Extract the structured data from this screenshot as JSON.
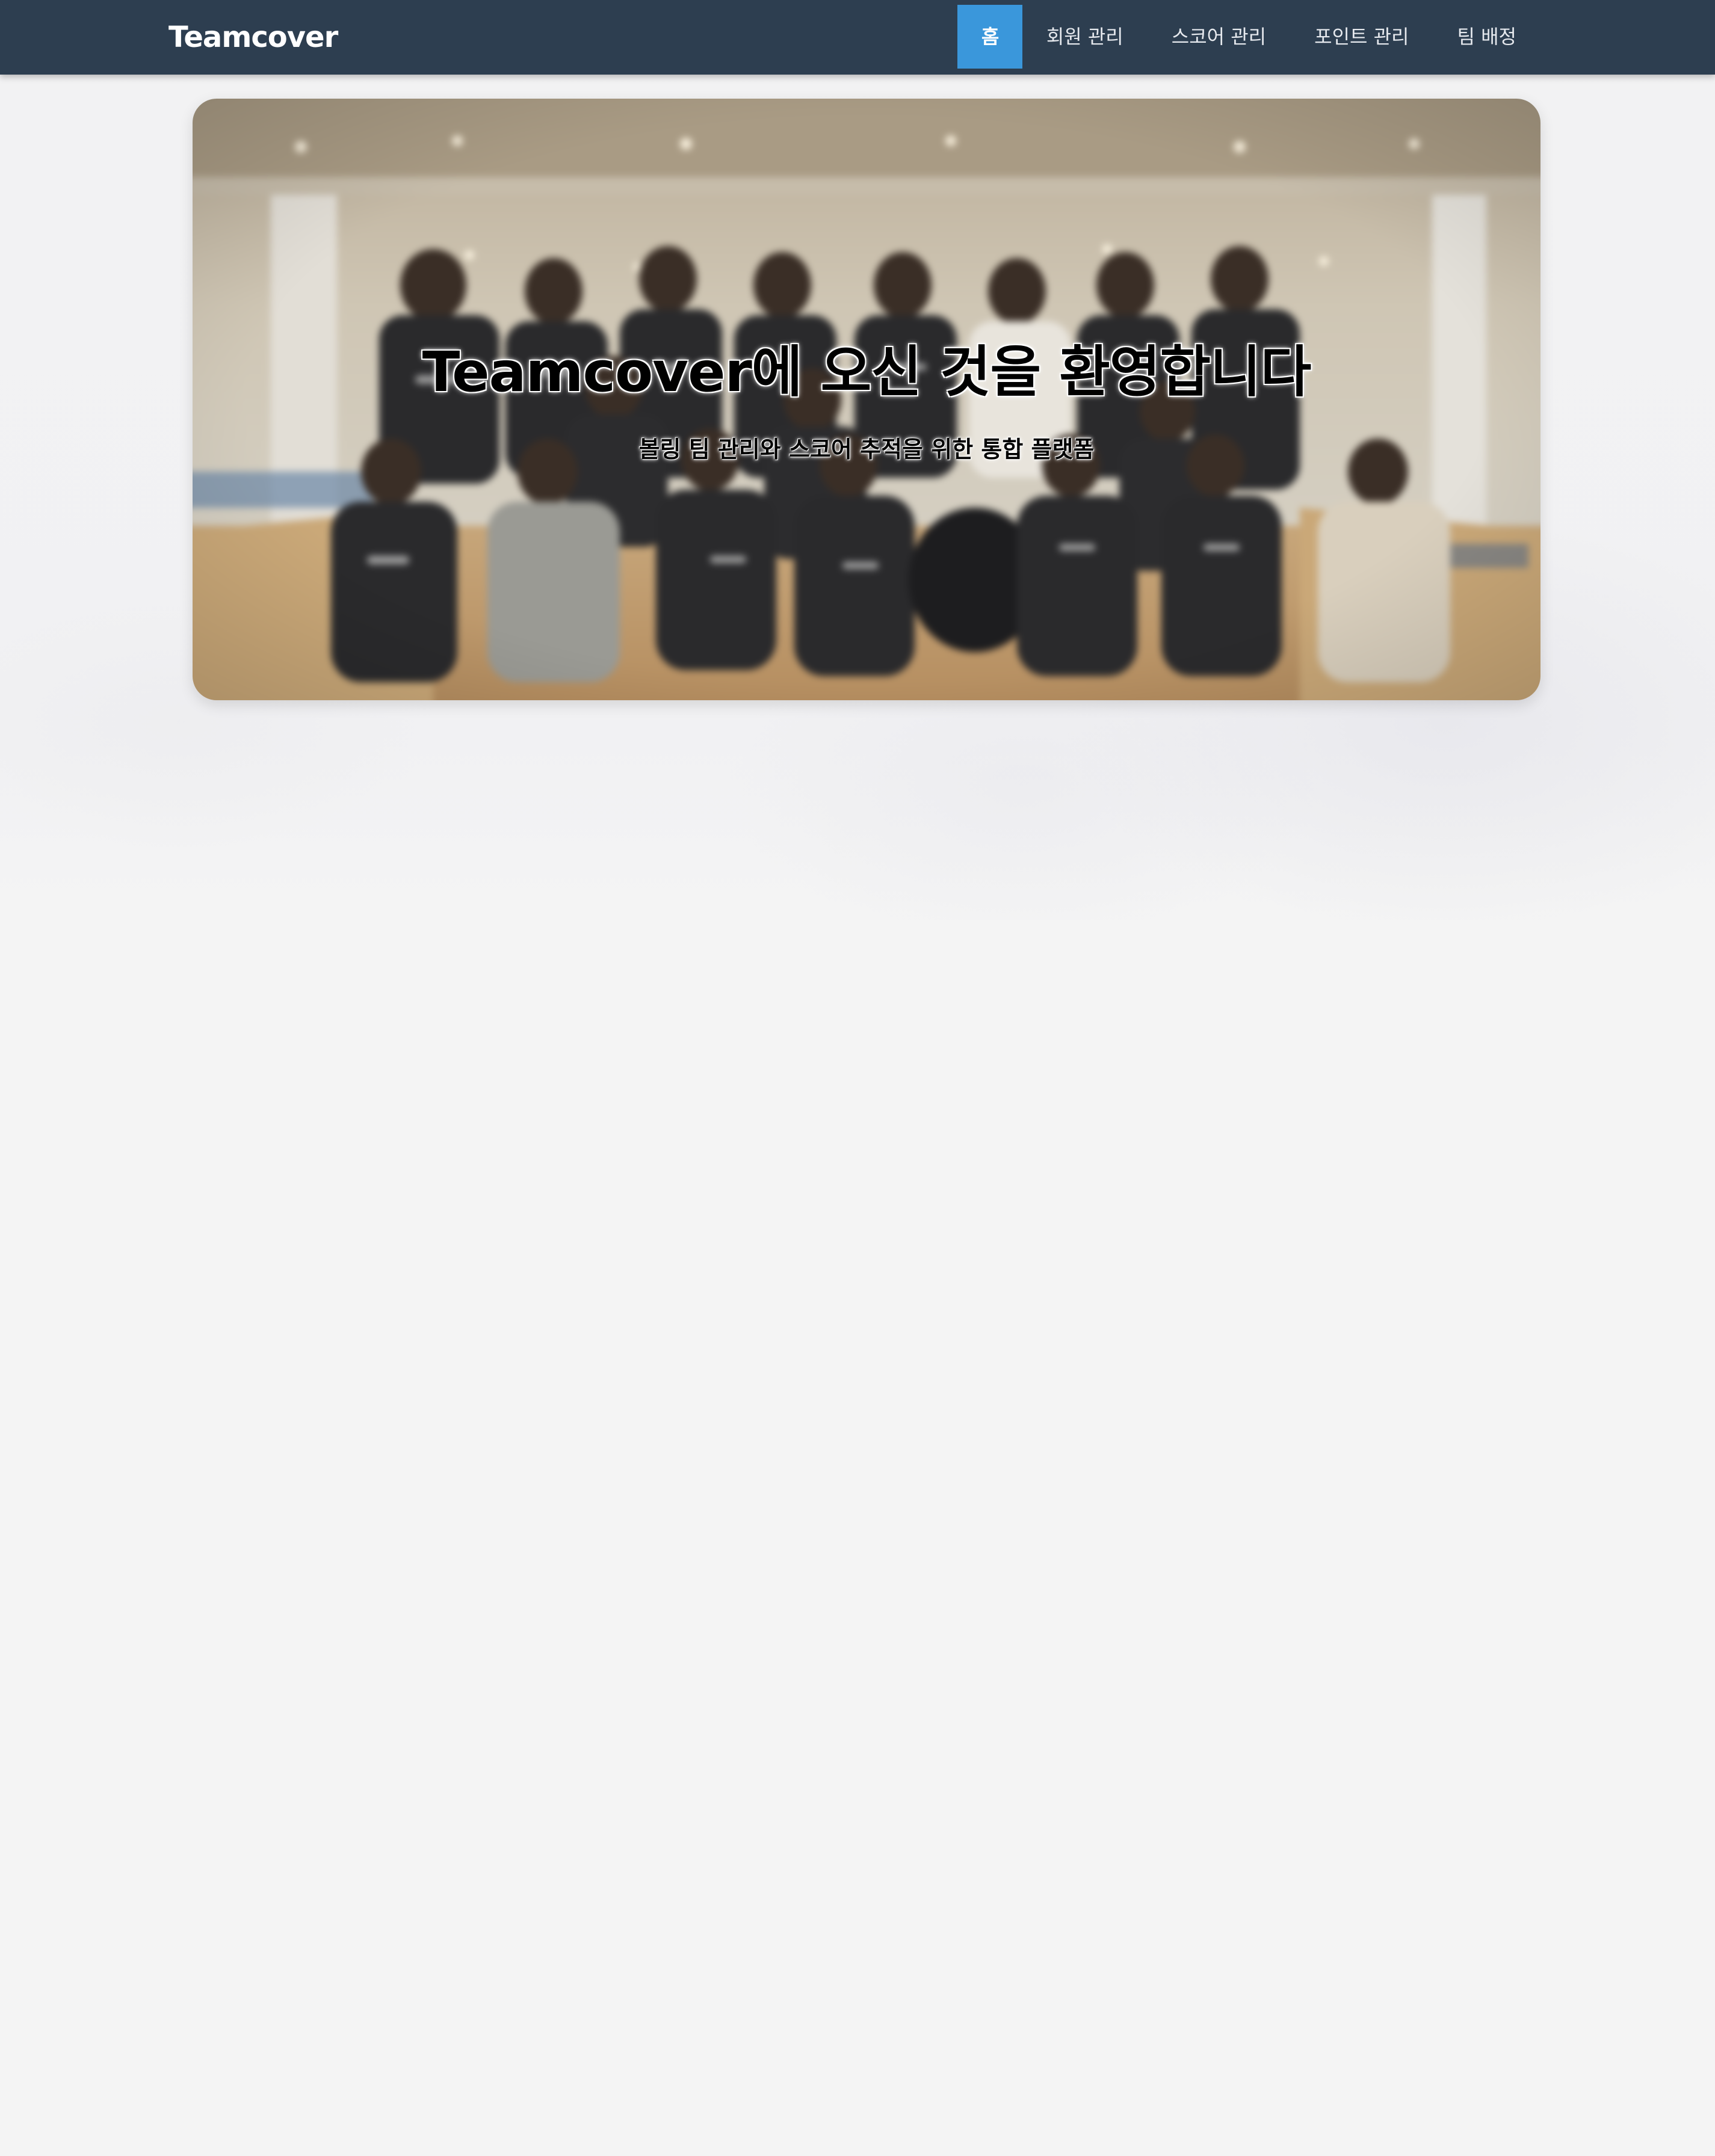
{
  "app": {
    "brand": "Teamcover"
  },
  "nav": {
    "items": [
      {
        "label": "홈",
        "active": true
      },
      {
        "label": "회원 관리",
        "active": false
      },
      {
        "label": "스코어 관리",
        "active": false
      },
      {
        "label": "포인트 관리",
        "active": false
      },
      {
        "label": "팀 배정",
        "active": false
      }
    ]
  },
  "hero": {
    "title": "Teamcover에 오신 것을 환영합니다",
    "subtitle": "볼링 팀 관리와 스코어 추적을 위한 통합 플랫폼"
  },
  "colors": {
    "navbar": "#2d3e50",
    "nav_active": "#3a97db",
    "page_background": "#f4f4f4"
  }
}
